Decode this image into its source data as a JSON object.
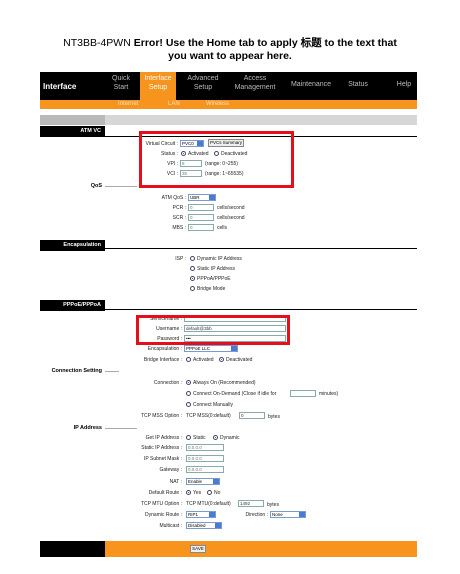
{
  "doc_title": {
    "model": "NT3BB-4PWN",
    "error": "Error! Use the Home tab to apply",
    "glyph": "标题",
    "rest": "to the text that",
    "line2": "you want to appear here."
  },
  "nav": {
    "brand": "Interface",
    "items": [
      {
        "l1": "Quick",
        "l2": "Start"
      },
      {
        "l1": "Interface",
        "l2": "Setup"
      },
      {
        "l1": "Advanced",
        "l2": "Setup"
      },
      {
        "l1": "Access",
        "l2": "Management"
      },
      {
        "l1": "Maintenance",
        "l2": ""
      },
      {
        "l1": "Status",
        "l2": ""
      },
      {
        "l1": "Help",
        "l2": ""
      }
    ],
    "sub": [
      "Internet",
      "LAN",
      "Wireless"
    ]
  },
  "sections": {
    "atm_vc": "ATM VC",
    "qos": "QoS",
    "encapsulation": "Encapsulation",
    "pppoe": "PPPoE/PPPoA",
    "connection": "Connection Setting",
    "ip": "IP Address"
  },
  "atm": {
    "vc_label": "Virtual Circuit :",
    "vc_value": "PVC0",
    "summary_btn": "PVCs Summary",
    "status_label": "Status :",
    "activated": "Activated",
    "deactivated": "Deactivated",
    "vpi_label": "VPI :",
    "vpi_value": "8",
    "vpi_range": "(range: 0~255)",
    "vci_label": "VCI :",
    "vci_value": "35",
    "vci_range": "(range: 1~65535)"
  },
  "qos": {
    "atm_qos_label": "ATM QoS :",
    "atm_qos_value": "UBR",
    "pcr_label": "PCR :",
    "pcr_value": "0",
    "scr_label": "SCR :",
    "scr_value": "0",
    "mbs_label": "MBS :",
    "mbs_value": "0",
    "unit_cells_sec": "cells/second",
    "unit_cells": "cells"
  },
  "encap": {
    "isp_label": "ISP :",
    "options": [
      "Dynamic IP Address",
      "Static IP Address",
      "PPPoA/PPPoE",
      "Bridge Mode"
    ]
  },
  "ppp": {
    "servicename_label": "Servicename :",
    "username_label": "Username :",
    "username_value": "default@3bb",
    "password_label": "Password :",
    "password_value": "•••",
    "encap_label": "Encapsulation :",
    "encap_value": "PPPoE LLC",
    "bridge_label": "Bridge Interface :",
    "activated": "Activated",
    "deactivated": "Deactivated"
  },
  "conn": {
    "connection_label": "Connection :",
    "always_on": "Always On (Recommended)",
    "on_demand": "Connect On-Demand (Close if idle for",
    "minutes": "minutes)",
    "manual": "Connect Manually",
    "mss_label": "TCP MSS Option :",
    "mss_text": "TCP MSS(0:default)",
    "mss_value": "0",
    "bytes": "bytes"
  },
  "ip": {
    "get_label": "Get IP Address :",
    "static": "Static",
    "dynamic": "Dynamic",
    "static_ip_label": "Static IP Address :",
    "static_ip_value": "0.0.0.0",
    "mask_label": "IP Subnet Mask :",
    "mask_value": "0.0.0.0",
    "gateway_label": "Gateway :",
    "gateway_value": "0.0.0.0",
    "nat_label": "NAT :",
    "nat_value": "Enable",
    "route_label": "Default Route :",
    "yes": "Yes",
    "no": "No",
    "mtu_label": "TCP MTU Option :",
    "mtu_text": "TCP MTU(0:default)",
    "mtu_value": "1492",
    "bytes": "bytes",
    "dyn_route_label": "Dynamic Route :",
    "dyn_route_value": "RIP1",
    "direction_label": "Direction :",
    "direction_value": "None",
    "multicast_label": "Multicast :",
    "multicast_value": "Disabled"
  },
  "footer": {
    "save": "SAVE"
  },
  "colors": {
    "accent": "#f7941d",
    "highlight": "#e3101b",
    "nav_bg": "#000000"
  }
}
